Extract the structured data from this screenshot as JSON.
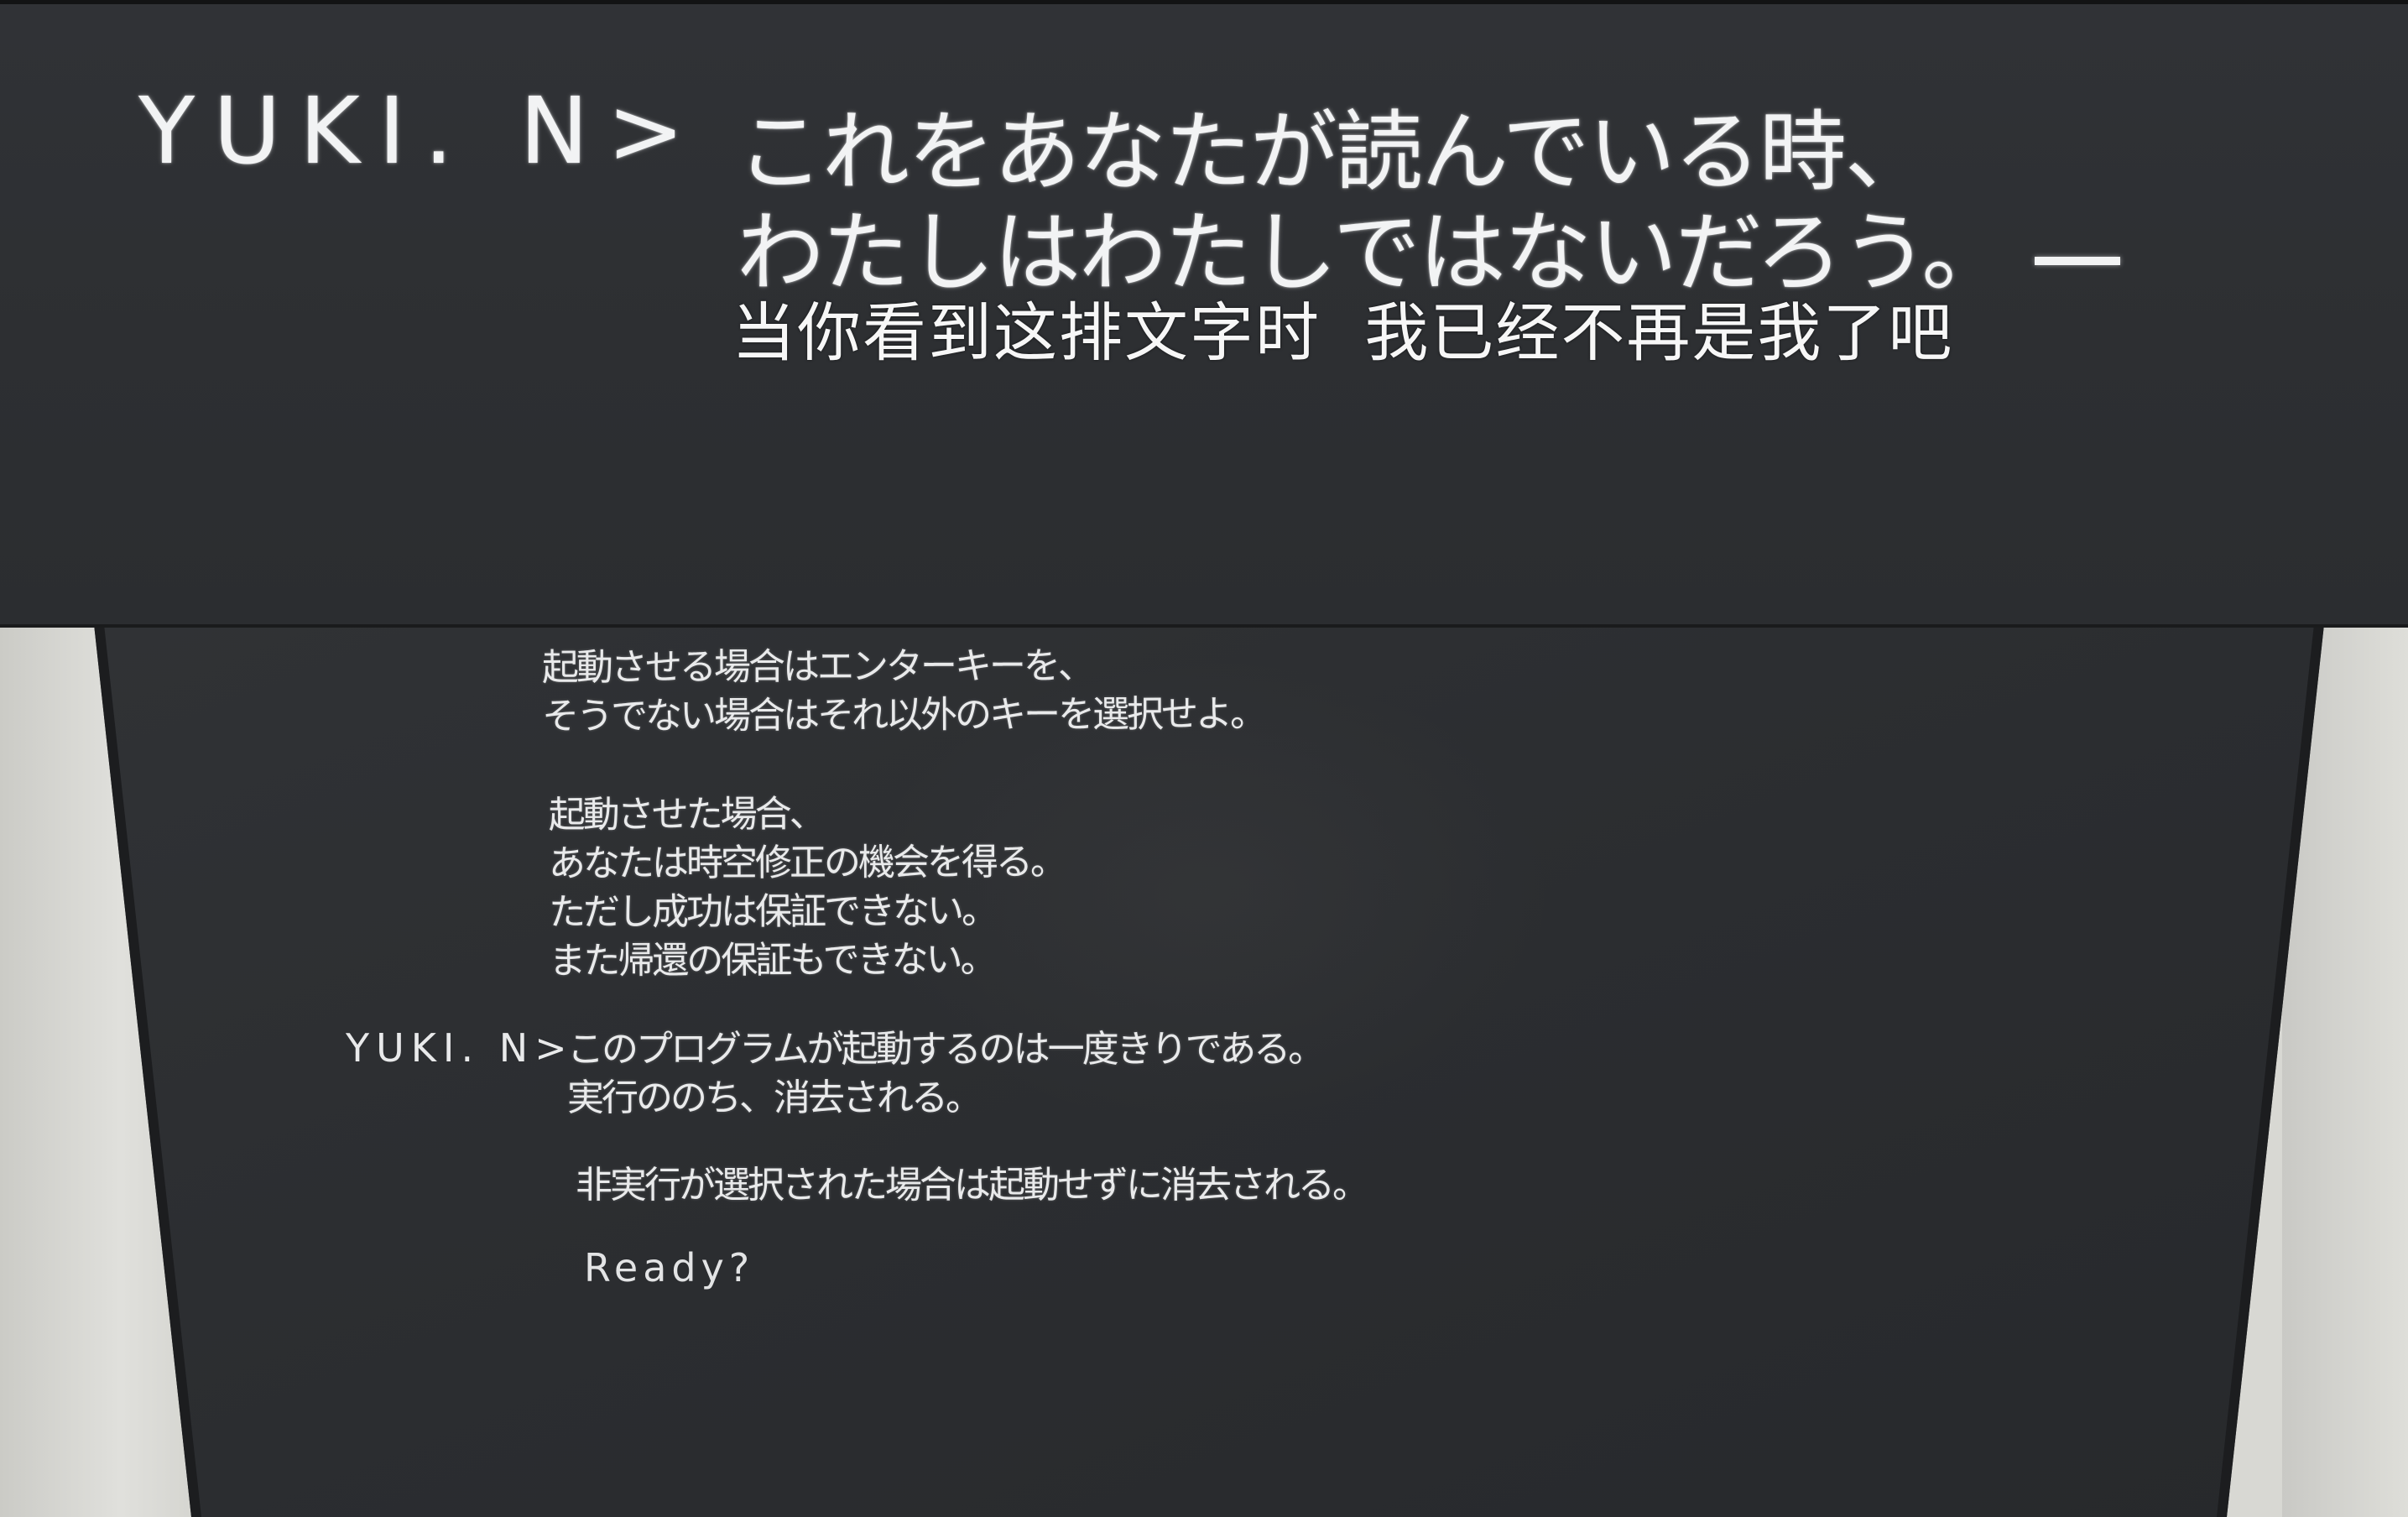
{
  "top": {
    "prompt": "YUKI. N>",
    "line1": "これをあなたが読んでいる時、",
    "line2": "わたしはわたしではないだろう。",
    "subtitle": "当你看到这排文字时  我已经不再是我了吧"
  },
  "terminal": {
    "para1": [
      "起動させる場合はエンターキーを、",
      "そうでない場合はそれ以外のキーを選択せよ。"
    ],
    "para2": [
      "起動させた場合、",
      "あなたは時空修正の機会を得る。",
      "ただし成功は保証できない。",
      "また帰還の保証もできない。"
    ],
    "prompt": "YUKI. N>",
    "para3": [
      "このプログラムが起動するのは一度きりである。",
      "実行ののち、消去される。"
    ],
    "para4": "非実行が選択された場合は起動せずに消去される。",
    "ready": "Ready?"
  },
  "colors": {
    "screen": "#2e3033",
    "text": "#f2f3f4",
    "wall": "#d8d8d3"
  }
}
